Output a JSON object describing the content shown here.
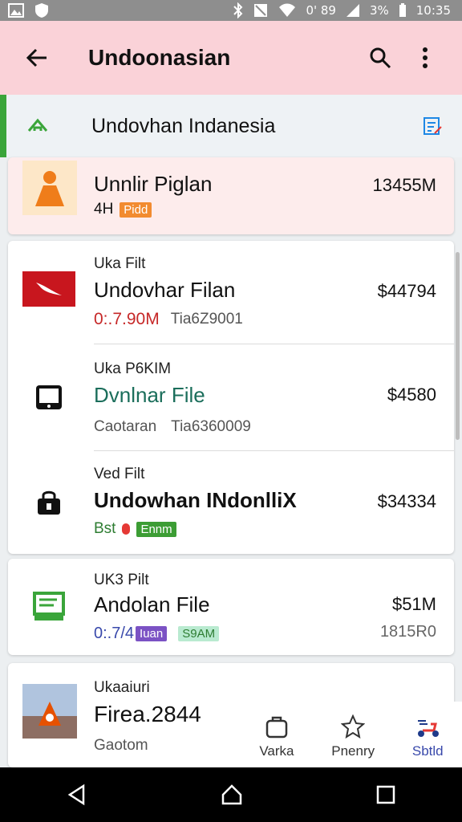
{
  "status_bar": {
    "signal_text": "0' 89",
    "battery": "3%",
    "time": "10:35"
  },
  "app_bar": {
    "title": "Undoonasian"
  },
  "location": {
    "text": "Undovhan Indanesia"
  },
  "items": [
    {
      "name": "Unnlir Piglan",
      "meta": "4H",
      "badge": "Pidd",
      "price": "13455M"
    },
    {
      "overline": "Uka Filt",
      "name": "Undovhar Filan",
      "meta_red": "0:.7.90M",
      "meta_gray": "Tia6Z9001",
      "price": "$44794"
    },
    {
      "overline": "Uka P6KIM",
      "name": "Dvnlnar File",
      "meta_gray1": "Caotaran",
      "meta_gray2": "Tia6360009",
      "price": "$4580"
    },
    {
      "overline": "Ved Filt",
      "name": "Undowhan INdonlliX",
      "meta": "Bst",
      "badge": "Ennm",
      "price": "$34334"
    },
    {
      "overline": "UK3 Pilt",
      "name": "Andolan File",
      "meta_blue": "0:.7/4",
      "badge1": "Iuan",
      "badge2": "S9AM",
      "price": "$51M",
      "price2": "1815R0"
    },
    {
      "overline": "Ukaaiuri",
      "name": "Firea.2844",
      "meta": "Gaotom"
    }
  ],
  "bottom_nav": [
    {
      "label": "Varka",
      "icon": "bag-icon"
    },
    {
      "label": "Pnenry",
      "icon": "star-icon"
    },
    {
      "label": "Sbtld",
      "icon": "scooter-icon"
    }
  ],
  "colors": {
    "appbar": "#fad2d8",
    "accent_green": "#3aa53a",
    "price_red": "#c62828",
    "teal": "#1b6e5b"
  }
}
